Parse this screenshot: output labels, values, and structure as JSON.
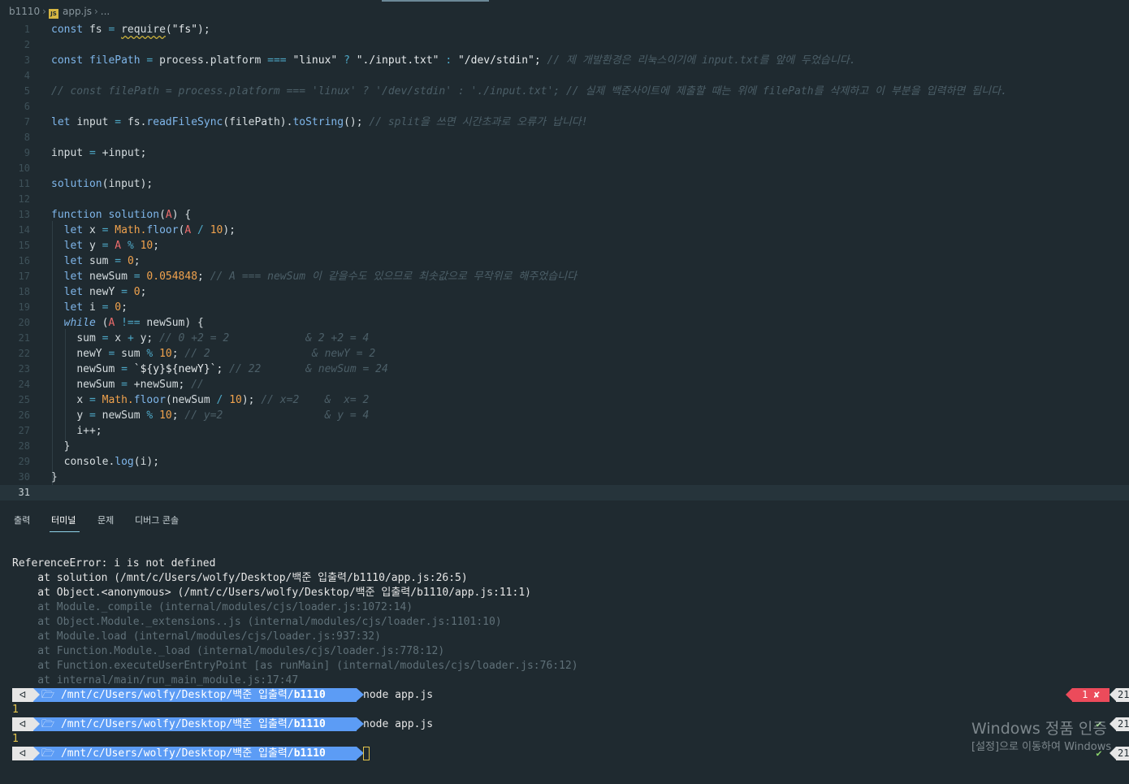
{
  "breadcrumb": {
    "folder": "b1110",
    "file": "app.js",
    "more": "..."
  },
  "editor": {
    "current_line": 31,
    "line_numbers": [
      "1",
      "2",
      "3",
      "4",
      "5",
      "6",
      "7",
      "8",
      "9",
      "10",
      "11",
      "12",
      "13",
      "14",
      "15",
      "16",
      "17",
      "18",
      "19",
      "20",
      "21",
      "22",
      "23",
      "24",
      "25",
      "26",
      "27",
      "28",
      "29",
      "30",
      "31"
    ],
    "code": {
      "l1": [
        "const",
        "fs",
        "=",
        "require",
        "(",
        "\"fs\"",
        ");"
      ],
      "l3": [
        "const",
        "filePath",
        "=",
        "process.platform",
        "===",
        "\"linux\"",
        "?",
        "\"./input.txt\"",
        ":",
        "\"/dev/stdin\";",
        "// 제 개발환경은 리눅스이기에 input.txt를 앞에 두었습니다."
      ],
      "l5": "// const filePath = process.platform === 'linux' ? '/dev/stdin' : './input.txt'; // 실제 백준사이트에 제출할 때는 위에 filePath를 삭제하고 이 부분을 입력하면 됩니다.",
      "l7": [
        "let",
        "input",
        "=",
        "fs.",
        "readFileSync",
        "(filePath).",
        "toString",
        "();",
        "// split을 쓰면 시간초과로 오류가 납니다!"
      ],
      "l9": [
        "input",
        "=",
        "+input;"
      ],
      "l11": [
        "solution",
        "(input);"
      ],
      "l13": [
        "function",
        "solution",
        "(",
        "A",
        ") {"
      ],
      "l14": [
        "let",
        "x",
        "=",
        "Math.",
        "floor",
        "(",
        "A",
        "/",
        "10",
        ");"
      ],
      "l15": [
        "let",
        "y",
        "=",
        "A",
        "%",
        "10",
        ";"
      ],
      "l16": [
        "let",
        "sum",
        "=",
        "0",
        ";"
      ],
      "l17": [
        "let",
        "newSum",
        "=",
        "0.054848",
        ";",
        "// A === newSum 이 같을수도 있으므로 최솟값으로 무작위로 해주었습니다"
      ],
      "l18": [
        "let",
        "newY",
        "=",
        "0",
        ";"
      ],
      "l19": [
        "let",
        "i",
        "=",
        "0",
        ";"
      ],
      "l20": [
        "while",
        "(",
        "A",
        "!==",
        "newSum) {"
      ],
      "l21": [
        "sum",
        "=",
        "x",
        "+",
        "y;",
        "// 0 +2 = 2            & 2 +2 = 4"
      ],
      "l22": [
        "newY",
        "=",
        "sum",
        "%",
        "10",
        ";",
        "// 2                & newY = 2"
      ],
      "l23": [
        "newSum",
        "=",
        "`${y}${newY}`;",
        "// 22       & newSum = 24"
      ],
      "l24": [
        "newSum",
        "=",
        "+newSum;",
        "//"
      ],
      "l25": [
        "x",
        "=",
        "Math.",
        "floor",
        "(newSum",
        "/",
        "10",
        ");",
        "// x=2    &  x= 2"
      ],
      "l26": [
        "y",
        "=",
        "newSum",
        "%",
        "10",
        ";",
        "// y=2                & y = 4"
      ],
      "l27": [
        "i++;"
      ],
      "l28": [
        "}"
      ],
      "l29": [
        "console.",
        "log",
        "(i);"
      ],
      "l30": [
        "}"
      ]
    }
  },
  "panel": {
    "tabs": [
      {
        "label": "출력"
      },
      {
        "label": "터미널"
      },
      {
        "label": "문제"
      },
      {
        "label": "디버그 콘솔"
      }
    ],
    "active_tab": "터미널",
    "terminal": {
      "error_lines": [
        "ReferenceError: i is not defined",
        "    at solution (/mnt/c/Users/wolfy/Desktop/백준 입출력/b1110/app.js:26:5)",
        "    at Object.<anonymous> (/mnt/c/Users/wolfy/Desktop/백준 입출력/b1110/app.js:11:1)"
      ],
      "dim_lines": [
        "    at Module._compile (internal/modules/cjs/loader.js:1072:14)",
        "    at Object.Module._extensions..js (internal/modules/cjs/loader.js:1101:10)",
        "    at Module.load (internal/modules/cjs/loader.js:937:32)",
        "    at Function.Module._load (internal/modules/cjs/loader.js:778:12)",
        "    at Function.executeUserEntryPoint [as runMain] (internal/modules/cjs/loader.js:76:12)",
        "    at internal/main/run_main_module.js:17:47"
      ],
      "prompt_path": "🗁 /mnt/c/Users/wolfy/Desktop/백준 입출력/",
      "prompt_dir": "b1110",
      "prompt_icon": "ᐊ",
      "commands": [
        "node app.js",
        "node app.js",
        ""
      ],
      "outputs": [
        "1",
        "1"
      ],
      "right_status": [
        {
          "type": "error",
          "text": "1 ✘",
          "time": "21"
        },
        {
          "type": "ok",
          "text": "✔",
          "time": "21"
        },
        {
          "type": "ok",
          "text": "✔",
          "time": "21"
        }
      ]
    }
  },
  "watermark": {
    "line1": "Windows 정품 인증",
    "line2": "[설정]으로 이동하여 Windows"
  },
  "colors": {
    "background": "#1f2a30",
    "keyword": "#7fb6ea",
    "number": "#f0a24d",
    "comment": "#4c5f68",
    "prompt_blue": "#5c9cf5",
    "error_red": "#ec4b5b"
  }
}
